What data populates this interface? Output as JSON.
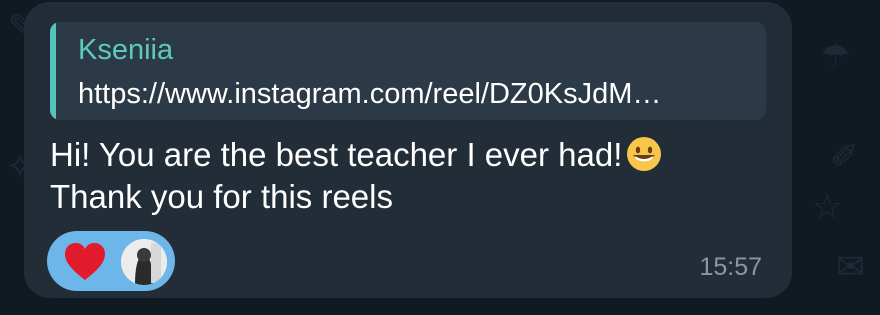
{
  "message": {
    "reply": {
      "name": "Kseniia",
      "link": "https://www.instagram.com/reel/DZ0KsJdM…"
    },
    "text_line1": "Hi! You are the best teacher I ever had!",
    "text_line2": "Thank you for this reels",
    "emoji_icon": "grinning-face-icon",
    "reaction": {
      "icon": "red-heart-icon",
      "avatar": "user-avatar"
    },
    "time": "15:57"
  },
  "colors": {
    "bubble": "#222d38",
    "reply_accent": "#5fc9c1",
    "reaction_pill": "#6cb6ea",
    "timestamp": "#8a96a3"
  }
}
